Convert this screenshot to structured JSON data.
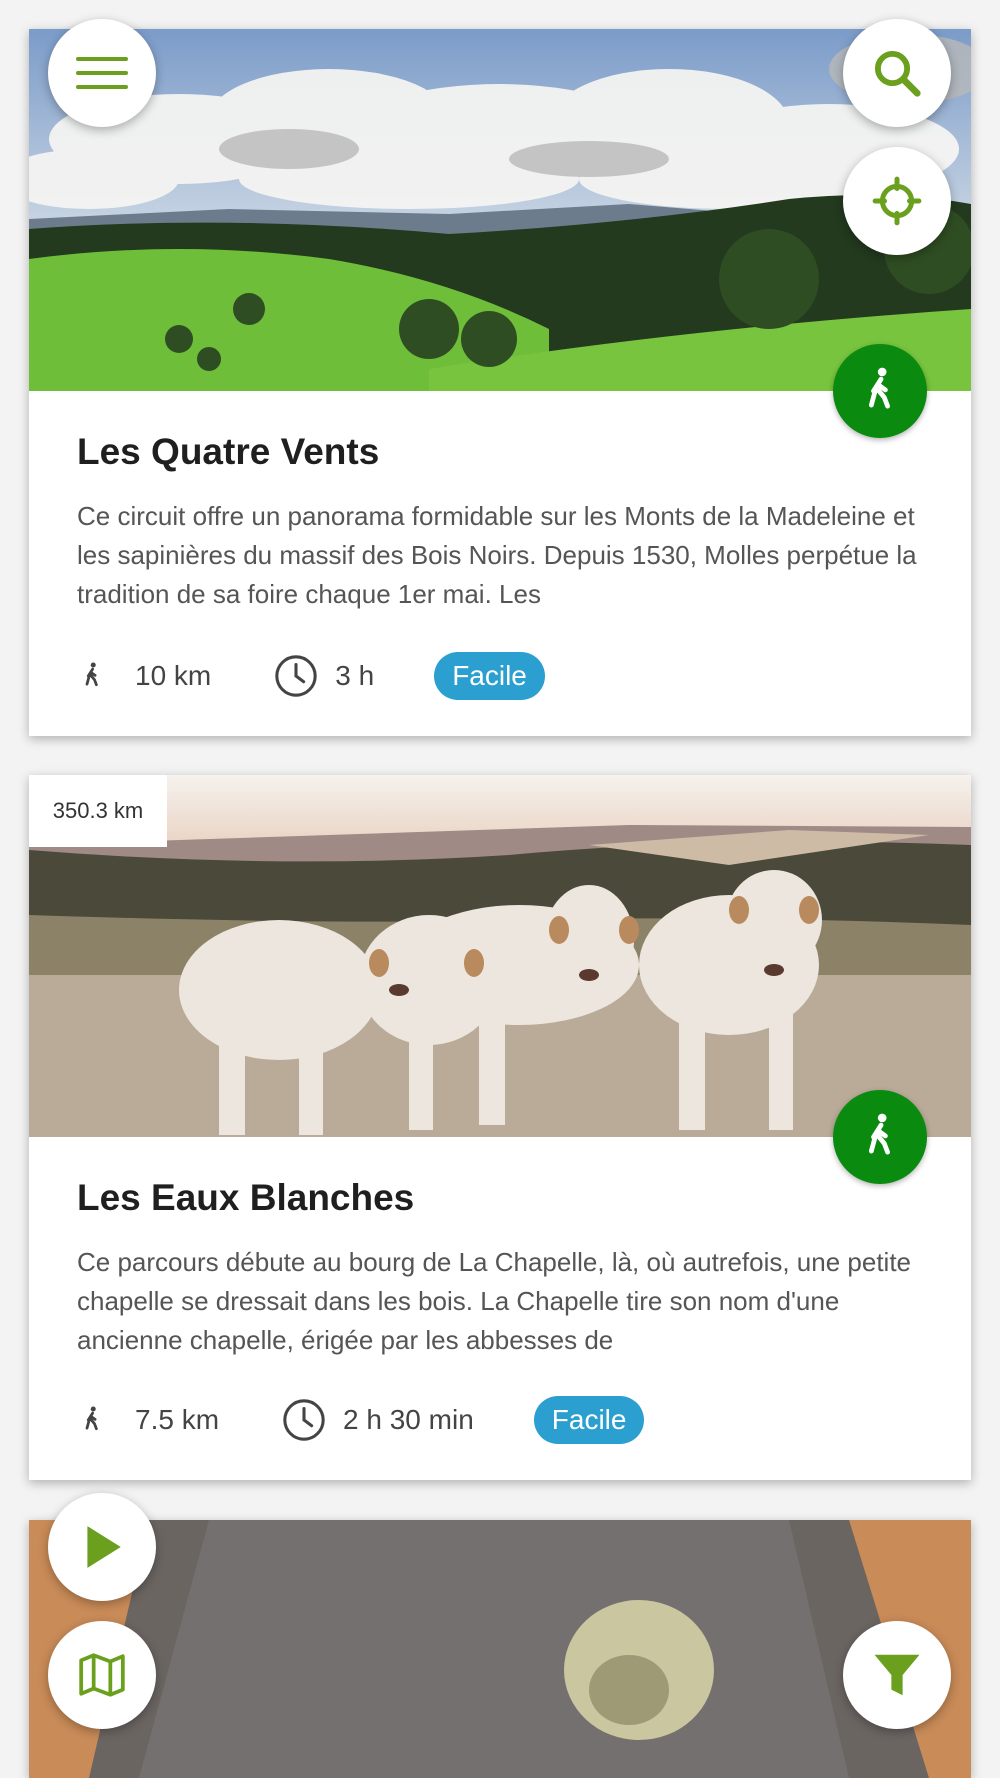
{
  "colors": {
    "accent": "#6aa01e",
    "hiking_badge": "#0b8a10",
    "level_badge": "#2b9fcf"
  },
  "controls": {
    "menu_icon": "hamburger-menu-icon",
    "search_icon": "search-icon",
    "locate_icon": "crosshair-location-icon",
    "play_icon": "play-icon",
    "map_icon": "map-icon",
    "filter_icon": "filter-funnel-icon"
  },
  "cards": [
    {
      "distance_from_user": "",
      "activity_icon": "hiking-icon",
      "title": "Les Quatre Vents",
      "description": "Ce circuit offre un panorama formidable sur les Monts de la Madeleine et les sapinières du massif des Bois Noirs. Depuis 1530, Molles perpétue la tradition de sa foire chaque 1er mai. Les",
      "length": "10 km",
      "duration": "3 h",
      "difficulty": "Facile",
      "image": "landscape of green hills and forest under cloudy sky"
    },
    {
      "distance_from_user": "350.3 km",
      "activity_icon": "hiking-icon",
      "title": "Les Eaux Blanches",
      "description": "Ce parcours débute au bourg de La Chapelle, là, où autrefois, une petite chapelle se dressait dans les bois. La Chapelle tire son nom d'une ancienne chapelle, érigée par les abbesses de",
      "length": "7.5 km",
      "duration": "2 h 30 min",
      "difficulty": "Facile",
      "image": "white cows standing in a frosty field"
    },
    {
      "distance_from_user": "",
      "image": "carved stone with lichen on a wooden floor"
    }
  ]
}
